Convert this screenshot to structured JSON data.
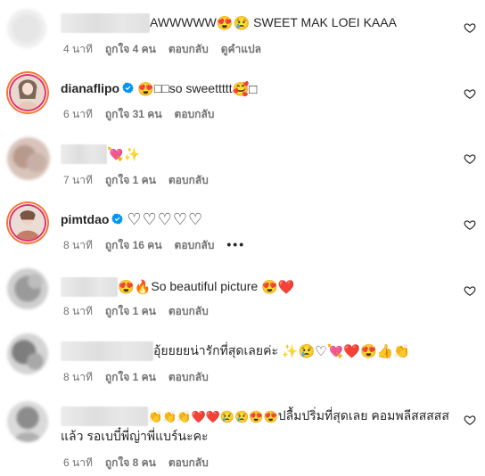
{
  "comments": [
    {
      "username": "",
      "text": "AWWWWW",
      "emoji": "😍😢",
      "text2": " SWEET MAK LOEI KAAA",
      "time": "4 นาที",
      "likes": "ถูกใจ 4 คน",
      "reply": "ตอบกลับ",
      "translate": "ดูคำแปล"
    },
    {
      "username": "dianaflipo",
      "emoji": "😍",
      "text": "□□so sweettttt",
      "emoji2": "🥰□",
      "time": "6 นาที",
      "likes": "ถูกใจ 31 คน",
      "reply": "ตอบกลับ"
    },
    {
      "username": "",
      "emoji": "💘✨",
      "time": "7 นาที",
      "likes": "ถูกใจ 1 คน",
      "reply": "ตอบกลับ"
    },
    {
      "username": "pimtdao",
      "emoji": "♡♡♡♡♡",
      "time": "8 นาที",
      "likes": "ถูกใจ 16 คน",
      "reply": "ตอบกลับ",
      "more": "•••"
    },
    {
      "username": "",
      "emoji": "😍🔥",
      "text": "So beautiful picture ",
      "emoji2": "😍❤️",
      "time": "8 นาที",
      "likes": "ถูกใจ 1 คน",
      "reply": "ตอบกลับ"
    },
    {
      "username": "",
      "text": "อุ้ยยยยน่ารักที่สุดเลยค่ะ ",
      "emoji": "✨😢♡💘❤️😍👍👏",
      "time": "8 นาที",
      "likes": "ถูกใจ 1 คน",
      "reply": "ตอบกลับ"
    },
    {
      "username": "",
      "emoji": "👏👏👏❤️❤️😢😢😍😍",
      "text": "ปลื้มปริ่มที่สุดเลย คอมพลีสสสสสแล้ว รอเบบี๋พี่ญ่าพี่แบร์นะคะ",
      "time": "6 นาที",
      "likes": "ถูกใจ 8 คน",
      "reply": "ตอบกลับ"
    }
  ],
  "colors": {
    "meta": "#737373",
    "verified": "#0095f6",
    "text": "#262626"
  },
  "icons": [
    "heart-outline-icon",
    "verified-badge-icon",
    "more-dots-icon"
  ]
}
